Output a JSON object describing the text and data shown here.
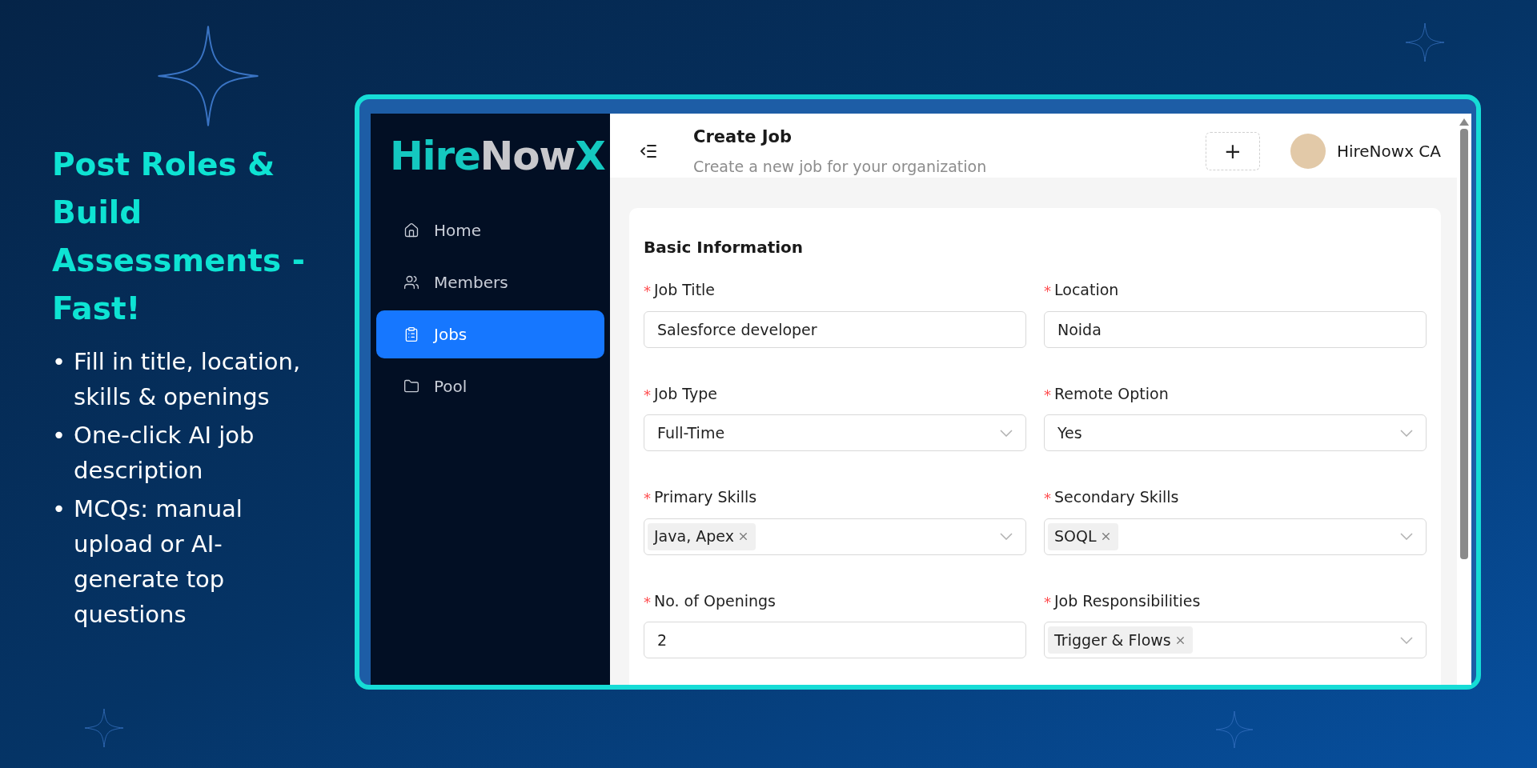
{
  "promo": {
    "heading": "Post Roles & Build Assessments - Fast!",
    "bullets": [
      {
        "marker": "•",
        "text": "Fill in title, location, skills & openings"
      },
      {
        "marker": "•",
        "text": "One-click AI job description"
      },
      {
        "marker": "•",
        "text": "MCQs: manual upload or AI-generate top questions"
      }
    ]
  },
  "sidebar": {
    "logo": [
      {
        "text": "Hire",
        "color": "#14c8c0"
      },
      {
        "text": "Now",
        "color": "#c8c8cc"
      },
      {
        "text": "X",
        "color": "#14c8c0"
      }
    ],
    "items": [
      {
        "label": "Home",
        "selected": false
      },
      {
        "label": "Members",
        "selected": false
      },
      {
        "label": "Jobs",
        "selected": true
      },
      {
        "label": "Pool",
        "selected": false
      }
    ]
  },
  "header": {
    "title": "Create Job",
    "subtitle": "Create a new job for your organization",
    "add_button": "+",
    "user": "HireNowx CA"
  },
  "form": {
    "section": "Basic Information",
    "fields": [
      {
        "label": "Job Title",
        "required_mark": "*",
        "kind": "text",
        "value": "Salesforce developer"
      },
      {
        "label": "Location",
        "required_mark": "*",
        "kind": "text",
        "value": "Noida"
      },
      {
        "label": "Job Type",
        "required_mark": "*",
        "kind": "select",
        "value": "Full-Time"
      },
      {
        "label": "Remote Option",
        "required_mark": "*",
        "kind": "select",
        "value": "Yes"
      },
      {
        "label": "Primary Skills",
        "required_mark": "*",
        "kind": "tags",
        "tags": [
          "Java, Apex"
        ]
      },
      {
        "label": "Secondary Skills",
        "required_mark": "*",
        "kind": "tags",
        "tags": [
          "SOQL"
        ]
      },
      {
        "label": "No. of Openings",
        "required_mark": "*",
        "kind": "text",
        "value": "2"
      },
      {
        "label": "Job Responsibilities",
        "required_mark": "*",
        "kind": "tags",
        "tags": [
          "Trigger & Flows"
        ]
      }
    ]
  }
}
